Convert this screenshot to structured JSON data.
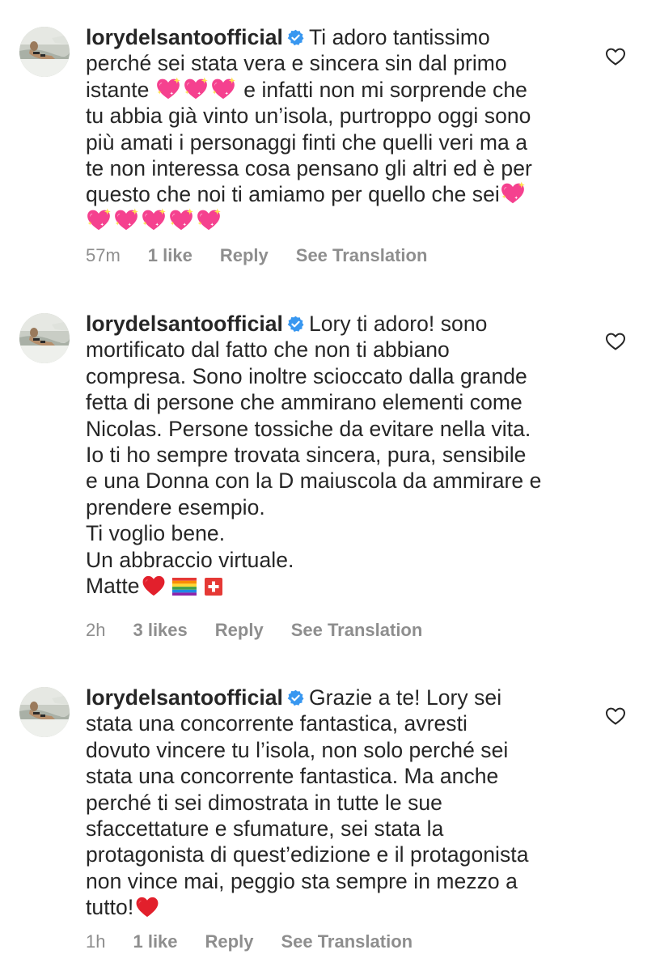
{
  "colors": {
    "text": "#262626",
    "meta": "#8e8e8e",
    "verified": "#3897f0",
    "heart_pink": "#f43f8e",
    "heart_red": "#e2202c"
  },
  "comments": [
    {
      "username": "lorydelsantoofficial",
      "verified_icon": "verified-badge-icon",
      "lines": [
        "Ti adoro tantissimo",
        "perché sei stata vera e sincera sin dal primo",
        "istante",
        "e infatti non mi sorprende che",
        "tu abbia già vinto un’isola, purtroppo oggi sono",
        "più amati i personaggi finti che quelli veri ma a",
        "te non interessa cosa pensano gli altri ed è per",
        "questo che noi ti amiamo per quello che sei"
      ],
      "emoji": "sparkling-heart-icon",
      "time": "57m",
      "likes": "1 like",
      "reply": "Reply",
      "translate": "See Translation"
    },
    {
      "username": "lorydelsantoofficial",
      "verified_icon": "verified-badge-icon",
      "lines": [
        "Lory ti adoro! sono",
        "mortificato dal fatto che non ti abbiano",
        "compresa. Sono inoltre scioccato dalla grande",
        "fetta di persone che ammirano elementi come",
        "Nicolas. Persone tossiche da evitare nella vita.",
        "Io ti ho sempre trovata sincera, pura, sensibile",
        "e una Donna con la D maiuscola da ammirare e",
        "prendere esempio.",
        "Ti voglio bene.",
        "Un abbraccio virtuale.",
        "Matte"
      ],
      "emoji": "red-heart-icon",
      "flags": [
        "rainbow-flag-icon",
        "swiss-flag-icon"
      ],
      "time": "2h",
      "likes": "3 likes",
      "reply": "Reply",
      "translate": "See Translation"
    },
    {
      "username": "lorydelsantoofficial",
      "verified_icon": "verified-badge-icon",
      "lines": [
        "Grazie a te! Lory sei",
        "stata una concorrente fantastica, avresti",
        "dovuto vincere tu l’isola, non solo perché sei",
        "stata una concorrente fantastica. Ma anche",
        "perché ti sei dimostrata in tutte le sue",
        "sfaccettature e sfumature, sei stata la",
        "protagonista di quest’edizione e il protagonista",
        "non vince mai, peggio sta sempre in mezzo a",
        "tutto!"
      ],
      "emoji": "red-heart-icon",
      "time": "1h",
      "likes": "1 like",
      "reply": "Reply",
      "translate": "See Translation"
    }
  ]
}
